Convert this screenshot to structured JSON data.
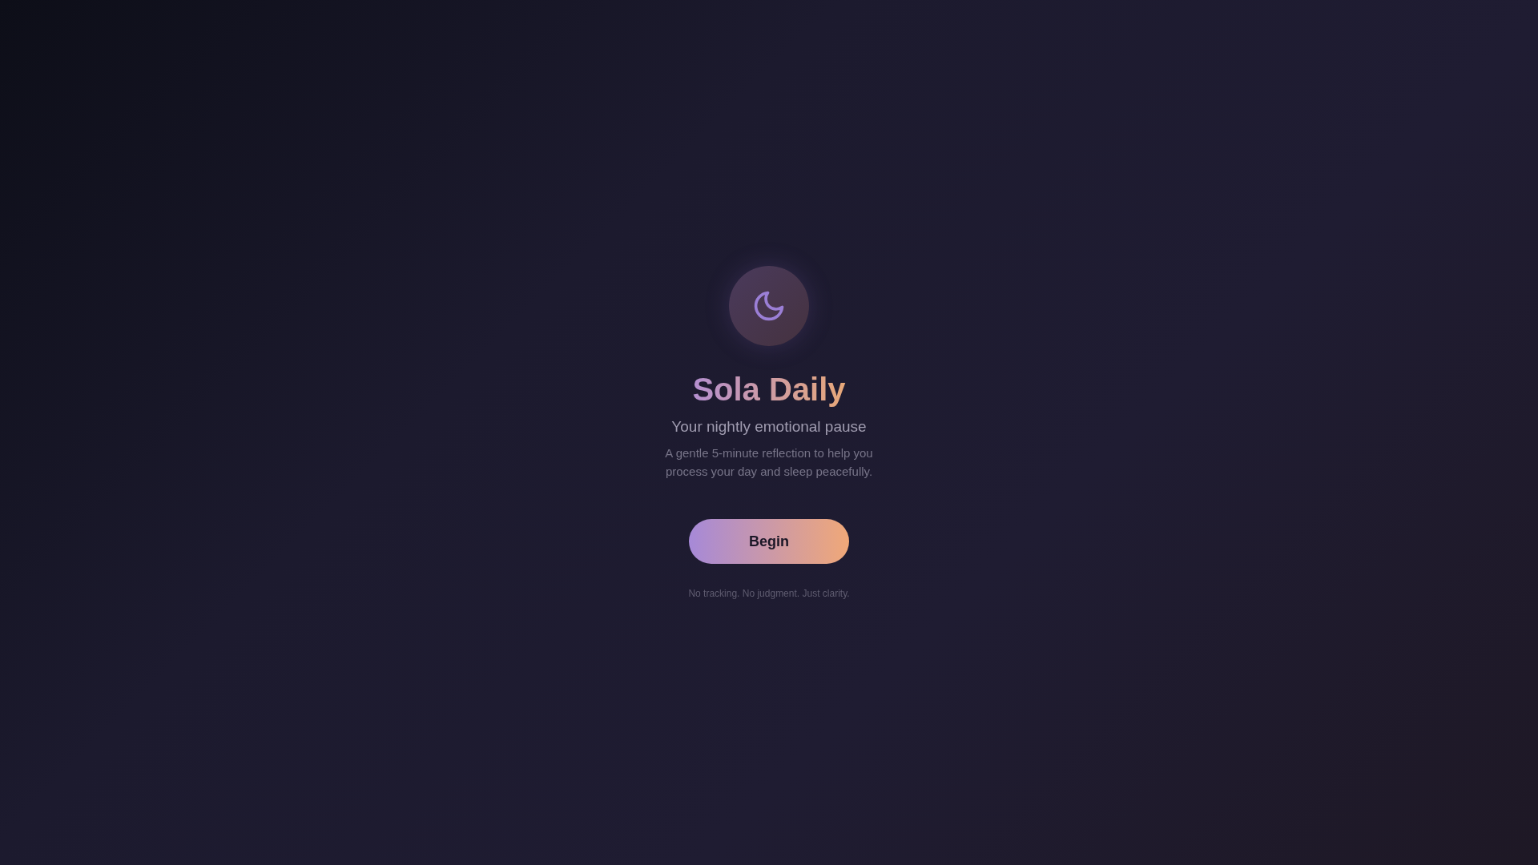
{
  "app": {
    "title": "Sola Daily",
    "tagline": "Your nightly emotional pause",
    "description": "A gentle 5-minute reflection to help you process your day and sleep peacefully.",
    "button": "Begin",
    "footer": "No tracking. No judgment. Just clarity."
  }
}
